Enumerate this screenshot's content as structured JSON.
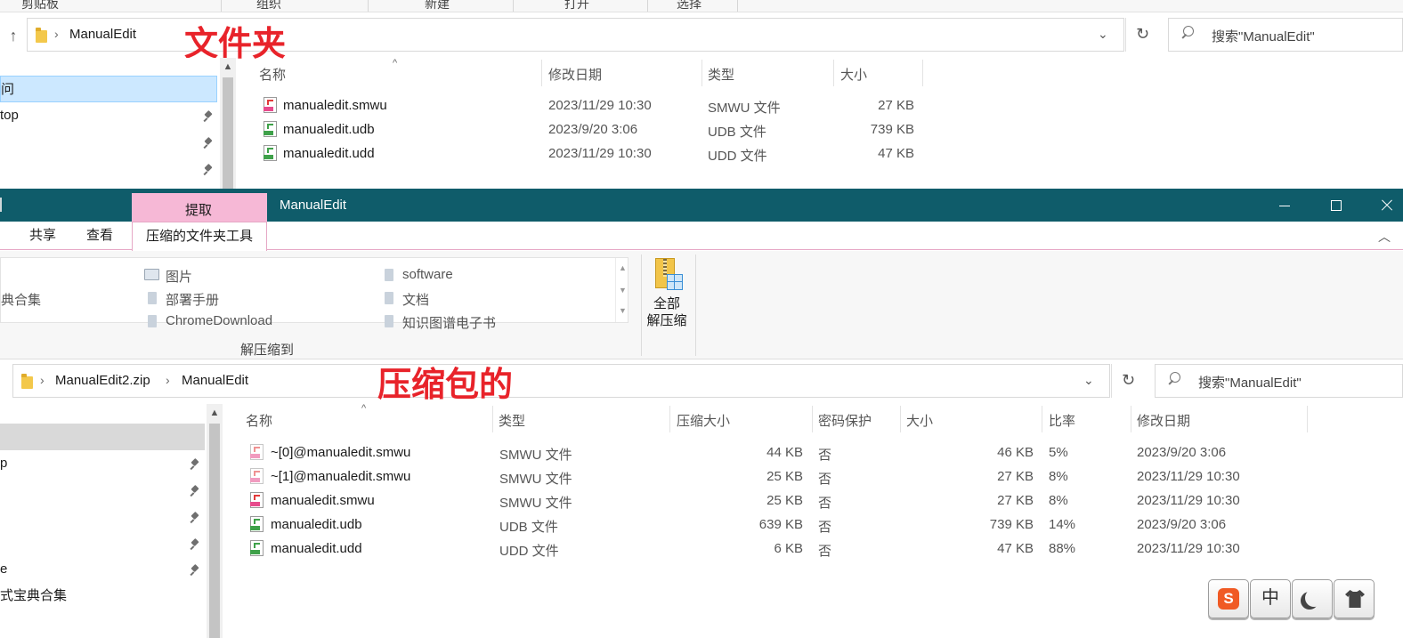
{
  "top_window": {
    "ribbon_group_labels": [
      "剪贴板",
      "组织",
      "新建",
      "打开",
      "选择"
    ],
    "address": {
      "crumbs": [
        "ManualEdit"
      ]
    },
    "annotation": "文件夹",
    "search_placeholder": "搜索\"ManualEdit\"",
    "nav_items": [
      {
        "label": "问",
        "pinned": false
      },
      {
        "label": "top",
        "pinned": true
      },
      {
        "label": "",
        "pinned": true
      },
      {
        "label": "",
        "pinned": true
      }
    ],
    "columns": [
      "名称",
      "修改日期",
      "类型",
      "大小"
    ],
    "files": [
      {
        "icon": "smwu",
        "name": "manualedit.smwu",
        "modified": "2023/11/29 10:30",
        "type": "SMWU 文件",
        "size": "27 KB"
      },
      {
        "icon": "udb",
        "name": "manualedit.udb",
        "modified": "2023/9/20 3:06",
        "type": "UDB 文件",
        "size": "739 KB"
      },
      {
        "icon": "udd",
        "name": "manualedit.udd",
        "modified": "2023/11/29 10:30",
        "type": "UDD 文件",
        "size": "47 KB"
      }
    ]
  },
  "zip_window": {
    "context_tab": "提取",
    "title": "ManualEdit",
    "tabs": [
      "共享",
      "查看",
      "压缩的文件夹工具"
    ],
    "gallery": {
      "left_partial": "典合集",
      "col1": [
        "图片",
        "部署手册",
        "ChromeDownload"
      ],
      "col2": [
        "software",
        "文档",
        "知识图谱电子书"
      ]
    },
    "group_label": "解压缩到",
    "extract_all_label": [
      "全部",
      "解压缩"
    ],
    "address": {
      "crumbs": [
        "ManualEdit2.zip",
        "ManualEdit"
      ]
    },
    "annotation": "压缩包的",
    "search_placeholder": "搜索\"ManualEdit\"",
    "nav_items": [
      {
        "label": "",
        "pinned": false,
        "selected": true
      },
      {
        "label": "p",
        "pinned": true
      },
      {
        "label": "",
        "pinned": true
      },
      {
        "label": "",
        "pinned": true
      },
      {
        "label": "",
        "pinned": true
      },
      {
        "label": "e",
        "pinned": true
      },
      {
        "label": "式宝典合集",
        "pinned": false
      }
    ],
    "columns": [
      "名称",
      "类型",
      "压缩大小",
      "密码保护",
      "大小",
      "比率",
      "修改日期"
    ],
    "files": [
      {
        "icon": "smwu-temp",
        "name": "~[0]@manualedit.smwu",
        "type": "SMWU 文件",
        "compressed": "44 KB",
        "password": "否",
        "size": "46 KB",
        "ratio": "5%",
        "modified": "2023/9/20 3:06"
      },
      {
        "icon": "smwu-temp",
        "name": "~[1]@manualedit.smwu",
        "type": "SMWU 文件",
        "compressed": "25 KB",
        "password": "否",
        "size": "27 KB",
        "ratio": "8%",
        "modified": "2023/11/29 10:30"
      },
      {
        "icon": "smwu",
        "name": "manualedit.smwu",
        "type": "SMWU 文件",
        "compressed": "25 KB",
        "password": "否",
        "size": "27 KB",
        "ratio": "8%",
        "modified": "2023/11/29 10:30"
      },
      {
        "icon": "udb",
        "name": "manualedit.udb",
        "type": "UDB 文件",
        "compressed": "639 KB",
        "password": "否",
        "size": "739 KB",
        "ratio": "14%",
        "modified": "2023/9/20 3:06"
      },
      {
        "icon": "udd",
        "name": "manualedit.udd",
        "type": "UDD 文件",
        "compressed": "6 KB",
        "password": "否",
        "size": "47 KB",
        "ratio": "88%",
        "modified": "2023/11/29 10:30"
      }
    ]
  },
  "ime_toolbar": {
    "mode_label": "中",
    "logo_label": "S",
    "icons": [
      "sogou-logo-icon",
      "moon-icon",
      "shirt-icon"
    ]
  },
  "colors": {
    "title_bar": "#0f5c6a",
    "context_tab": "#f6b8d6",
    "annotation": "#e8232a",
    "nav_selected": "#cce8ff"
  }
}
